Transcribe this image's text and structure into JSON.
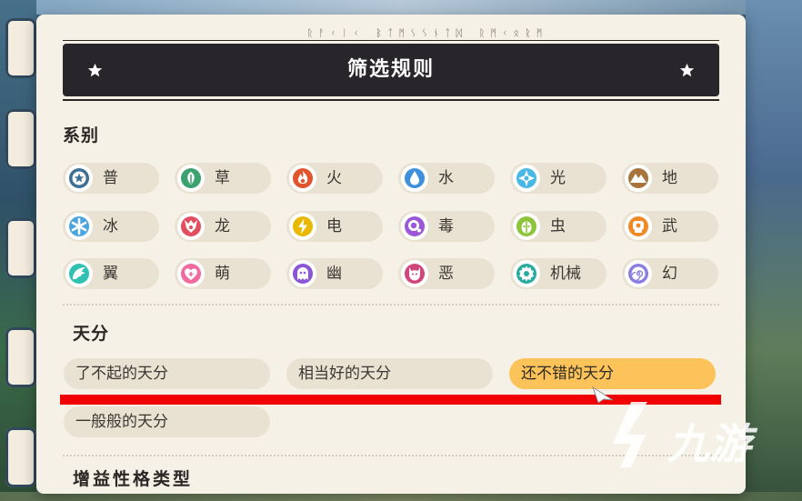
{
  "dialog": {
    "runes": "ᚱᚨᚲᛁᚲ ᛒᛏᛗᛊᛊᚾᛏᛞ ᚱᛗᚲᛟᚱᛗ",
    "title": "筛选规则"
  },
  "types": {
    "heading": "系别",
    "items": [
      {
        "label": "普",
        "icon": "star-badge-icon",
        "color": "#3d6f93"
      },
      {
        "label": "草",
        "icon": "leaf-icon",
        "color": "#3aa26e"
      },
      {
        "label": "火",
        "icon": "flame-icon",
        "color": "#e2542b"
      },
      {
        "label": "水",
        "icon": "water-drop-icon",
        "color": "#3e8fdc"
      },
      {
        "label": "光",
        "icon": "sun-icon",
        "color": "#49b8e6"
      },
      {
        "label": "地",
        "icon": "mountain-icon",
        "color": "#a8743c"
      },
      {
        "label": "冰",
        "icon": "snowflake-icon",
        "color": "#4aa4e0"
      },
      {
        "label": "龙",
        "icon": "dragon-icon",
        "color": "#e24d5f"
      },
      {
        "label": "电",
        "icon": "lightning-icon",
        "color": "#e9b800"
      },
      {
        "label": "毒",
        "icon": "poison-bubble-icon",
        "color": "#9b57d6"
      },
      {
        "label": "虫",
        "icon": "bug-icon",
        "color": "#8ec43b"
      },
      {
        "label": "武",
        "icon": "fist-icon",
        "color": "#f08a25"
      },
      {
        "label": "翼",
        "icon": "wing-icon",
        "color": "#2fc2b2"
      },
      {
        "label": "萌",
        "icon": "heart-icon",
        "color": "#f16b9e"
      },
      {
        "label": "幽",
        "icon": "ghost-icon",
        "color": "#8a55d6"
      },
      {
        "label": "恶",
        "icon": "demon-icon",
        "color": "#d0457b"
      },
      {
        "label": "机械",
        "icon": "gear-icon",
        "color": "#2bab9f"
      },
      {
        "label": "幻",
        "icon": "spiral-icon",
        "color": "#8a7fe0"
      }
    ]
  },
  "talent": {
    "heading": "天分",
    "options": [
      {
        "label": "了不起的天分",
        "selected": false
      },
      {
        "label": "相当好的天分",
        "selected": false
      },
      {
        "label": "还不错的天分",
        "selected": true
      },
      {
        "label": "一般般的天分",
        "selected": false
      }
    ]
  },
  "next_section": {
    "heading": "增益性格类型"
  },
  "watermark": {
    "text": "九游"
  }
}
